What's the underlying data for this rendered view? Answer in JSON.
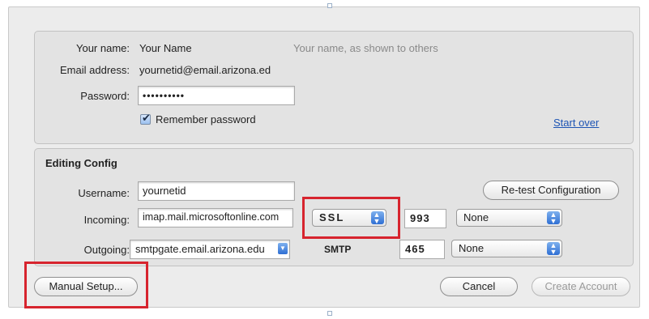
{
  "account": {
    "name_label": "Your name:",
    "name_value": "Your Name",
    "name_hint": "Your name, as shown to others",
    "email_label": "Email address:",
    "email_value": "yournetid@email.arizona.ed",
    "password_label": "Password:",
    "password_value": "••••••••••",
    "remember_label": "Remember password",
    "remember_checked": true,
    "start_over_label": "Start over"
  },
  "config": {
    "title": "Editing Config",
    "username_label": "Username:",
    "username_value": "yournetid",
    "retest_label": "Re-test Configuration",
    "incoming_label": "Incoming:",
    "incoming_server": "imap.mail.microsoftonline.com",
    "incoming_security": "SSL",
    "incoming_port": "993",
    "incoming_auth": "None",
    "outgoing_label": "Outgoing:",
    "outgoing_server": "smtpgate.email.arizona.edu",
    "outgoing_protocol": "SMTP",
    "outgoing_port": "465",
    "outgoing_auth": "None"
  },
  "footer": {
    "manual_setup_label": "Manual Setup...",
    "cancel_label": "Cancel",
    "create_account_label": "Create Account"
  },
  "colors": {
    "highlight": "#d7242e",
    "link": "#1d54b4"
  }
}
